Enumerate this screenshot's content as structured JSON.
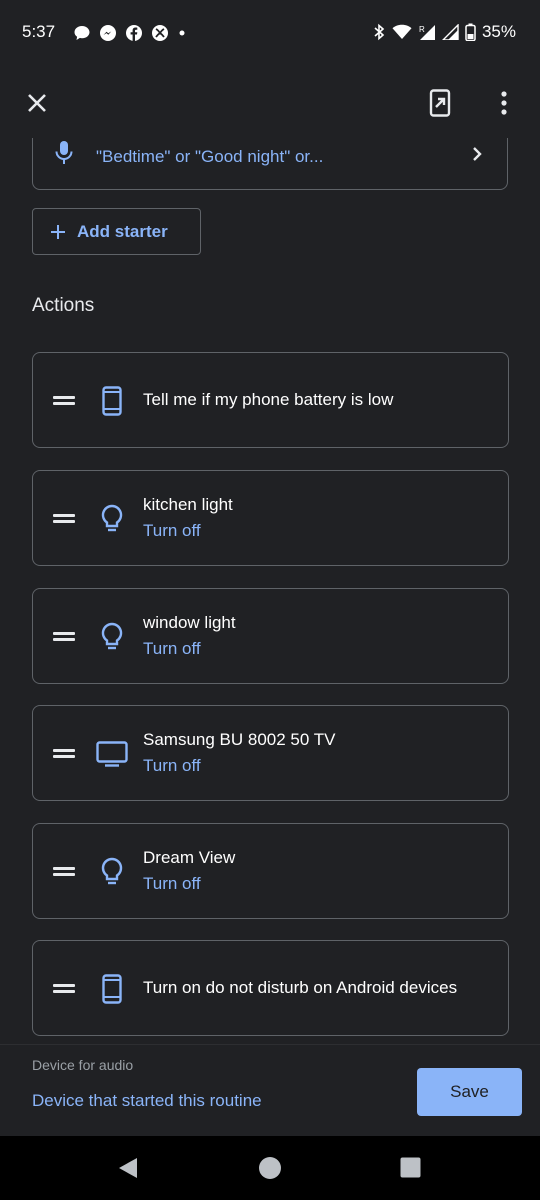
{
  "status_bar": {
    "time": "5:37",
    "battery": "35%",
    "left_icons": [
      "chat-bubble-icon",
      "messenger-icon",
      "facebook-icon",
      "xbox-icon",
      "dot-icon"
    ],
    "right_icons": [
      "bluetooth-icon",
      "wifi-icon",
      "signal-roaming-icon",
      "signal-icon",
      "battery-icon"
    ]
  },
  "app_bar": {
    "close_icon": "close-icon",
    "open_icon": "open-in-app-icon",
    "more_icon": "more-vert-icon"
  },
  "starter": {
    "text": "\"Bedtime\" or \"Good night\" or..."
  },
  "add_starter": {
    "label": "Add starter"
  },
  "actions_section": {
    "title": "Actions",
    "items": [
      {
        "title": "Tell me if my phone battery is low",
        "subtitle": "",
        "icon": "phone-icon"
      },
      {
        "title": "kitchen light",
        "subtitle": "Turn off",
        "icon": "lightbulb-icon"
      },
      {
        "title": "window light",
        "subtitle": "Turn off",
        "icon": "lightbulb-icon"
      },
      {
        "title": "Samsung BU 8002 50 TV",
        "subtitle": "Turn off",
        "icon": "tv-icon"
      },
      {
        "title": "Dream View",
        "subtitle": "Turn off",
        "icon": "lightbulb-icon"
      },
      {
        "title": "Turn on do not disturb on Android devices",
        "subtitle": "",
        "icon": "phone-icon"
      }
    ]
  },
  "audio": {
    "label": "Device for audio",
    "value": "Device that started this routine"
  },
  "save_label": "Save",
  "colors": {
    "background": "#202124",
    "accent": "#8ab4f8",
    "border": "#5f6368",
    "nav_bar": "#000000"
  }
}
